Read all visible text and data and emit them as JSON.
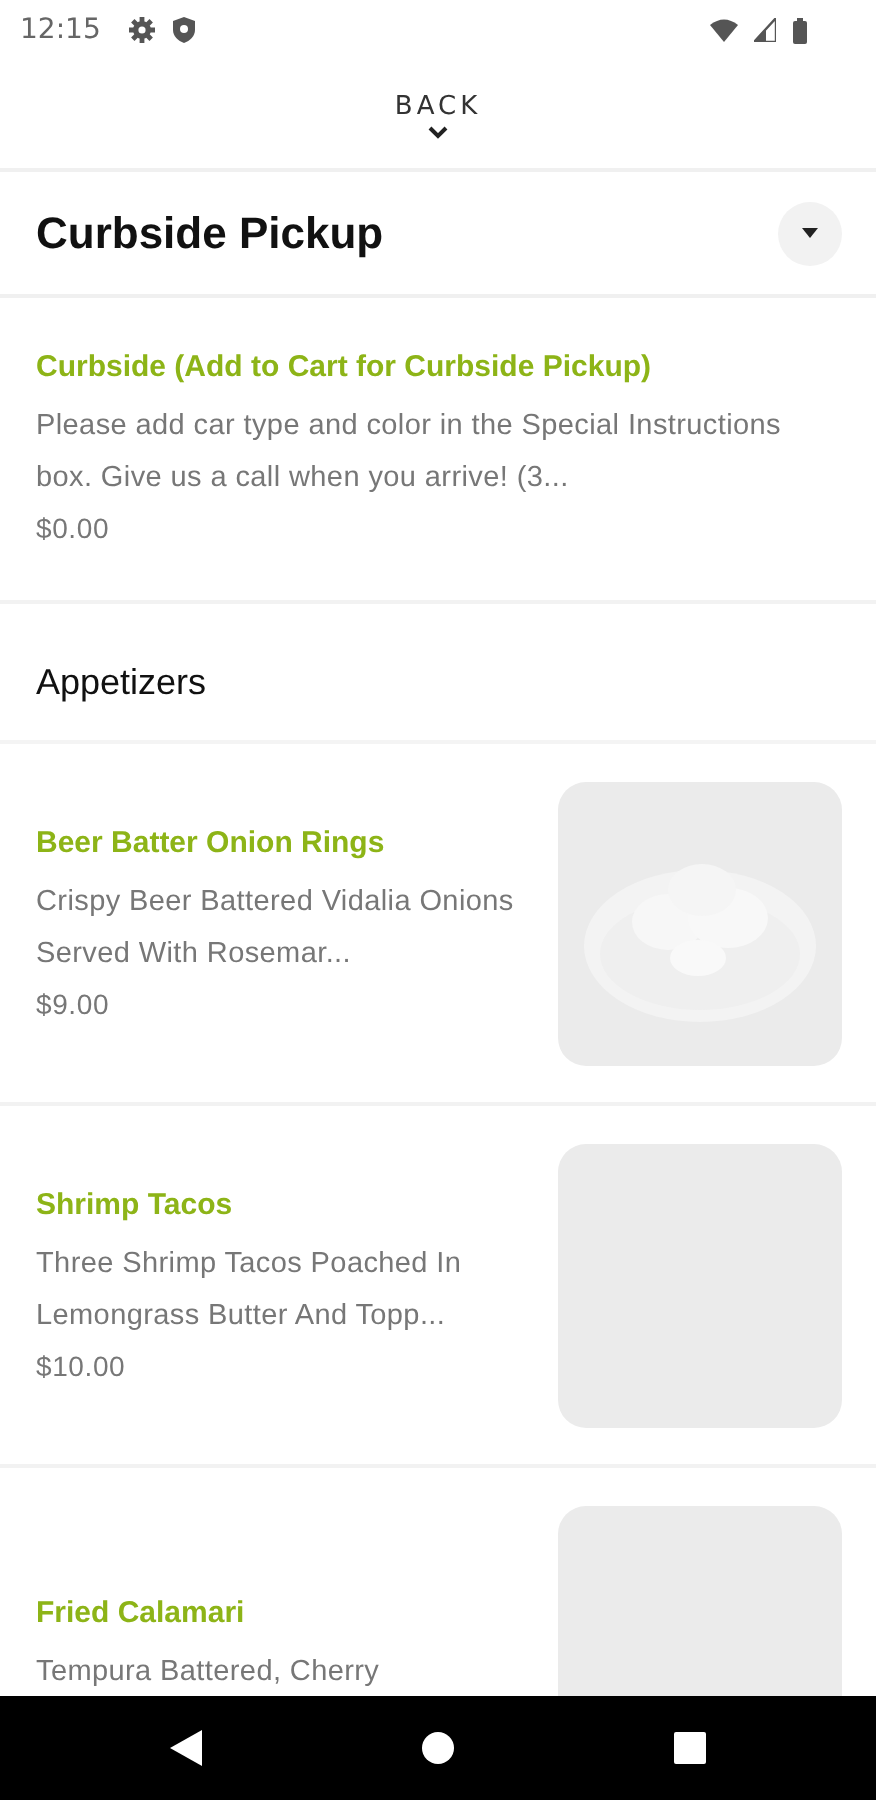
{
  "status_bar": {
    "time": "12:15"
  },
  "back": {
    "label": "BACK"
  },
  "header": {
    "title": "Curbside Pickup"
  },
  "sections": [
    {
      "items": [
        {
          "kind": "plain",
          "name": "Curbside (Add to Cart for Curbside Pickup)",
          "description": "Please add car type and color in the Special Instructions box. Give us a call when you arrive! (3...",
          "price": "$0.00"
        }
      ]
    },
    {
      "title": "Appetizers",
      "items": [
        {
          "kind": "picture",
          "name": "Beer Batter Onion Rings",
          "description": "Crispy Beer Battered Vidalia Onions Served With Rosemar...",
          "price": "$9.00"
        },
        {
          "kind": "placeholder",
          "name": "Shrimp Tacos",
          "description": "Three Shrimp Tacos Poached In Lemongrass Butter And Topp...",
          "price": "$10.00"
        },
        {
          "kind": "placeholder",
          "name": "Fried Calamari",
          "description": "Tempura Battered, Cherry"
        }
      ]
    }
  ]
}
